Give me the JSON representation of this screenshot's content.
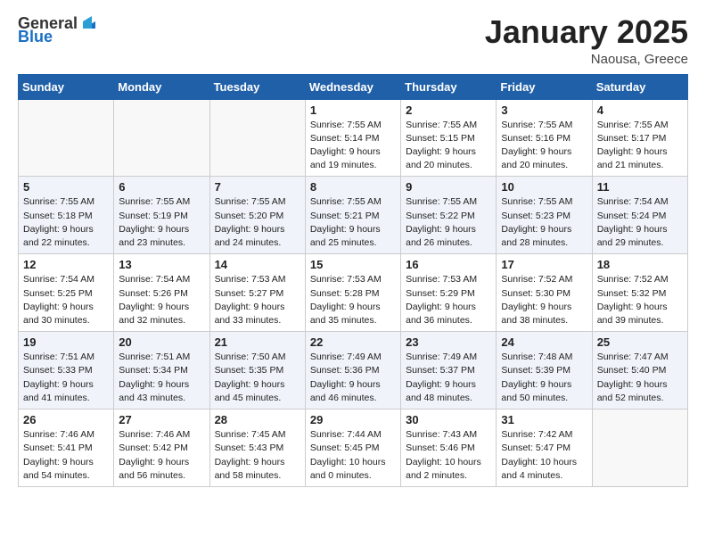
{
  "logo": {
    "general": "General",
    "blue": "Blue"
  },
  "title": {
    "month": "January 2025",
    "location": "Naousa, Greece"
  },
  "headers": [
    "Sunday",
    "Monday",
    "Tuesday",
    "Wednesday",
    "Thursday",
    "Friday",
    "Saturday"
  ],
  "weeks": [
    [
      {
        "day": "",
        "info": ""
      },
      {
        "day": "",
        "info": ""
      },
      {
        "day": "",
        "info": ""
      },
      {
        "day": "1",
        "info": "Sunrise: 7:55 AM\nSunset: 5:14 PM\nDaylight: 9 hours\nand 19 minutes."
      },
      {
        "day": "2",
        "info": "Sunrise: 7:55 AM\nSunset: 5:15 PM\nDaylight: 9 hours\nand 20 minutes."
      },
      {
        "day": "3",
        "info": "Sunrise: 7:55 AM\nSunset: 5:16 PM\nDaylight: 9 hours\nand 20 minutes."
      },
      {
        "day": "4",
        "info": "Sunrise: 7:55 AM\nSunset: 5:17 PM\nDaylight: 9 hours\nand 21 minutes."
      }
    ],
    [
      {
        "day": "5",
        "info": "Sunrise: 7:55 AM\nSunset: 5:18 PM\nDaylight: 9 hours\nand 22 minutes."
      },
      {
        "day": "6",
        "info": "Sunrise: 7:55 AM\nSunset: 5:19 PM\nDaylight: 9 hours\nand 23 minutes."
      },
      {
        "day": "7",
        "info": "Sunrise: 7:55 AM\nSunset: 5:20 PM\nDaylight: 9 hours\nand 24 minutes."
      },
      {
        "day": "8",
        "info": "Sunrise: 7:55 AM\nSunset: 5:21 PM\nDaylight: 9 hours\nand 25 minutes."
      },
      {
        "day": "9",
        "info": "Sunrise: 7:55 AM\nSunset: 5:22 PM\nDaylight: 9 hours\nand 26 minutes."
      },
      {
        "day": "10",
        "info": "Sunrise: 7:55 AM\nSunset: 5:23 PM\nDaylight: 9 hours\nand 28 minutes."
      },
      {
        "day": "11",
        "info": "Sunrise: 7:54 AM\nSunset: 5:24 PM\nDaylight: 9 hours\nand 29 minutes."
      }
    ],
    [
      {
        "day": "12",
        "info": "Sunrise: 7:54 AM\nSunset: 5:25 PM\nDaylight: 9 hours\nand 30 minutes."
      },
      {
        "day": "13",
        "info": "Sunrise: 7:54 AM\nSunset: 5:26 PM\nDaylight: 9 hours\nand 32 minutes."
      },
      {
        "day": "14",
        "info": "Sunrise: 7:53 AM\nSunset: 5:27 PM\nDaylight: 9 hours\nand 33 minutes."
      },
      {
        "day": "15",
        "info": "Sunrise: 7:53 AM\nSunset: 5:28 PM\nDaylight: 9 hours\nand 35 minutes."
      },
      {
        "day": "16",
        "info": "Sunrise: 7:53 AM\nSunset: 5:29 PM\nDaylight: 9 hours\nand 36 minutes."
      },
      {
        "day": "17",
        "info": "Sunrise: 7:52 AM\nSunset: 5:30 PM\nDaylight: 9 hours\nand 38 minutes."
      },
      {
        "day": "18",
        "info": "Sunrise: 7:52 AM\nSunset: 5:32 PM\nDaylight: 9 hours\nand 39 minutes."
      }
    ],
    [
      {
        "day": "19",
        "info": "Sunrise: 7:51 AM\nSunset: 5:33 PM\nDaylight: 9 hours\nand 41 minutes."
      },
      {
        "day": "20",
        "info": "Sunrise: 7:51 AM\nSunset: 5:34 PM\nDaylight: 9 hours\nand 43 minutes."
      },
      {
        "day": "21",
        "info": "Sunrise: 7:50 AM\nSunset: 5:35 PM\nDaylight: 9 hours\nand 45 minutes."
      },
      {
        "day": "22",
        "info": "Sunrise: 7:49 AM\nSunset: 5:36 PM\nDaylight: 9 hours\nand 46 minutes."
      },
      {
        "day": "23",
        "info": "Sunrise: 7:49 AM\nSunset: 5:37 PM\nDaylight: 9 hours\nand 48 minutes."
      },
      {
        "day": "24",
        "info": "Sunrise: 7:48 AM\nSunset: 5:39 PM\nDaylight: 9 hours\nand 50 minutes."
      },
      {
        "day": "25",
        "info": "Sunrise: 7:47 AM\nSunset: 5:40 PM\nDaylight: 9 hours\nand 52 minutes."
      }
    ],
    [
      {
        "day": "26",
        "info": "Sunrise: 7:46 AM\nSunset: 5:41 PM\nDaylight: 9 hours\nand 54 minutes."
      },
      {
        "day": "27",
        "info": "Sunrise: 7:46 AM\nSunset: 5:42 PM\nDaylight: 9 hours\nand 56 minutes."
      },
      {
        "day": "28",
        "info": "Sunrise: 7:45 AM\nSunset: 5:43 PM\nDaylight: 9 hours\nand 58 minutes."
      },
      {
        "day": "29",
        "info": "Sunrise: 7:44 AM\nSunset: 5:45 PM\nDaylight: 10 hours\nand 0 minutes."
      },
      {
        "day": "30",
        "info": "Sunrise: 7:43 AM\nSunset: 5:46 PM\nDaylight: 10 hours\nand 2 minutes."
      },
      {
        "day": "31",
        "info": "Sunrise: 7:42 AM\nSunset: 5:47 PM\nDaylight: 10 hours\nand 4 minutes."
      },
      {
        "day": "",
        "info": ""
      }
    ]
  ]
}
